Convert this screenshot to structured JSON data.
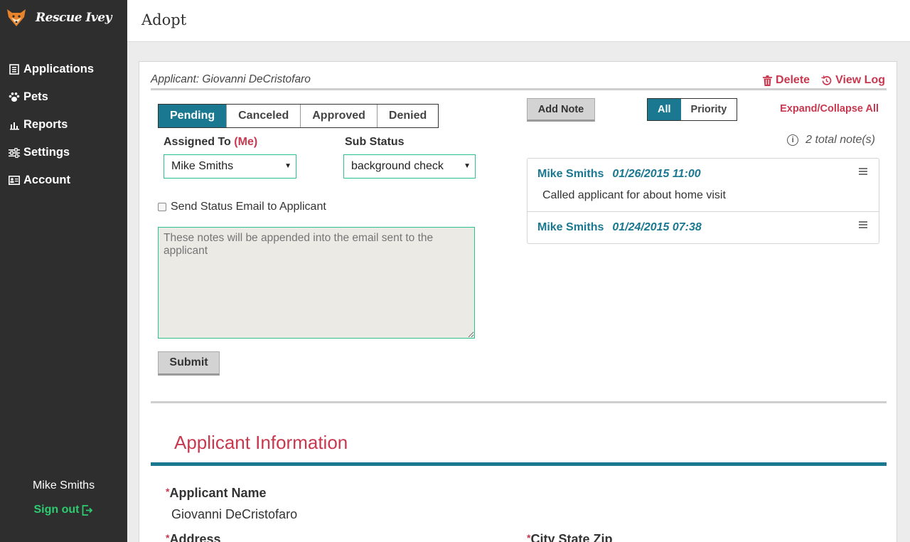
{
  "app": {
    "name": "Rescue Ivey"
  },
  "sidebar": {
    "items": [
      {
        "label": "Applications",
        "icon": "document-icon"
      },
      {
        "label": "Pets",
        "icon": "paw-icon"
      },
      {
        "label": "Reports",
        "icon": "bar-chart-icon"
      },
      {
        "label": "Settings",
        "icon": "sliders-icon"
      },
      {
        "label": "Account",
        "icon": "id-card-icon"
      }
    ],
    "user_name": "Mike Smiths",
    "sign_out": "Sign out"
  },
  "header": {
    "title": "Adopt"
  },
  "application": {
    "applicant_line": "Applicant: Giovanni DeCristofaro",
    "delete_label": "Delete",
    "view_log_label": "View Log",
    "status_tabs": [
      {
        "label": "Pending",
        "active": true
      },
      {
        "label": "Canceled",
        "active": false
      },
      {
        "label": "Approved",
        "active": false
      },
      {
        "label": "Denied",
        "active": false
      }
    ],
    "assigned_to": {
      "label": "Assigned To",
      "me_label": "(Me)",
      "value": "Mike Smiths"
    },
    "sub_status": {
      "label": "Sub Status",
      "value": "background check"
    },
    "send_email_label": "Send Status Email to Applicant",
    "send_email_checked": false,
    "email_notes_placeholder": "These notes will be appended into the email sent to the applicant",
    "submit_label": "Submit"
  },
  "notes": {
    "add_note_label": "Add Note",
    "filters": [
      {
        "label": "All",
        "active": true
      },
      {
        "label": "Priority",
        "active": false
      }
    ],
    "expand_collapse_label": "Expand/Collapse All",
    "total_label": "2 total note(s)",
    "items": [
      {
        "author": "Mike Smiths",
        "date": "01/26/2015 11:00",
        "body": "Called applicant for about home visit"
      },
      {
        "author": "Mike Smiths",
        "date": "01/24/2015 07:38",
        "body": ""
      }
    ]
  },
  "applicant_info": {
    "title": "Applicant Information",
    "required_mark": "*",
    "name_label": "Applicant Name",
    "name_value": "Giovanni DeCristofaro",
    "address_label": "Address",
    "city_state_zip_label": "City State Zip"
  },
  "colors": {
    "accent_teal": "#1a7891",
    "brand_red": "#c8384f",
    "sidebar_bg": "#2e2e2e",
    "signout_green": "#2ecc71"
  }
}
